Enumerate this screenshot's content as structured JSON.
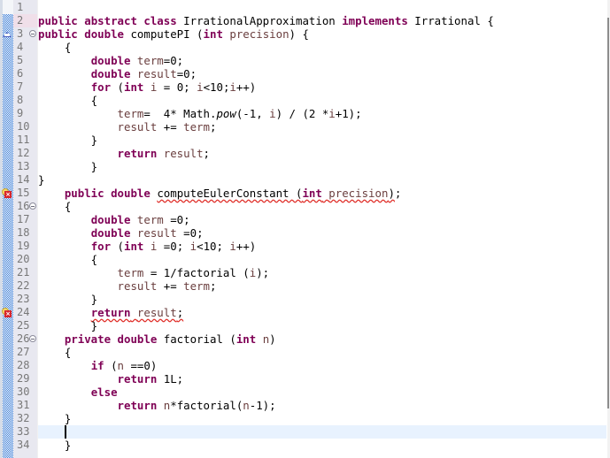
{
  "editor": {
    "language": "java",
    "current_line": 33,
    "colors": {
      "keyword": "#7f0055",
      "local_variable": "#6a3e3e",
      "line_number": "#787878",
      "current_line_bg": "#e8f2fe",
      "error_underline": "#e0302a"
    },
    "lines": [
      {
        "n": "1",
        "tokens": []
      },
      {
        "n": "2",
        "tokens": [
          {
            "t": "public",
            "c": "kw"
          },
          {
            "t": " "
          },
          {
            "t": "abstract",
            "c": "kw"
          },
          {
            "t": " "
          },
          {
            "t": "class",
            "c": "kw"
          },
          {
            "t": " IrrationalApproximation "
          },
          {
            "t": "implements",
            "c": "kw"
          },
          {
            "t": " Irrational {"
          }
        ]
      },
      {
        "n": "3",
        "tokens": [
          {
            "t": "public",
            "c": "kw"
          },
          {
            "t": " "
          },
          {
            "t": "double",
            "c": "kw"
          },
          {
            "t": " computePI ("
          },
          {
            "t": "int",
            "c": "kw"
          },
          {
            "t": " "
          },
          {
            "t": "precision",
            "c": "var"
          },
          {
            "t": ") {"
          }
        ]
      },
      {
        "n": "4",
        "tokens": [
          {
            "t": "    {"
          }
        ]
      },
      {
        "n": "5",
        "tokens": [
          {
            "t": "        "
          },
          {
            "t": "double",
            "c": "kw"
          },
          {
            "t": " "
          },
          {
            "t": "term",
            "c": "var"
          },
          {
            "t": "=0;"
          }
        ]
      },
      {
        "n": "6",
        "tokens": [
          {
            "t": "        "
          },
          {
            "t": "double",
            "c": "kw"
          },
          {
            "t": " "
          },
          {
            "t": "result",
            "c": "var"
          },
          {
            "t": "=0;"
          }
        ]
      },
      {
        "n": "7",
        "tokens": [
          {
            "t": "        "
          },
          {
            "t": "for",
            "c": "kw"
          },
          {
            "t": " ("
          },
          {
            "t": "int",
            "c": "kw"
          },
          {
            "t": " "
          },
          {
            "t": "i",
            "c": "var"
          },
          {
            "t": " = 0; "
          },
          {
            "t": "i",
            "c": "var"
          },
          {
            "t": "<10;"
          },
          {
            "t": "i",
            "c": "var"
          },
          {
            "t": "++)"
          }
        ]
      },
      {
        "n": "8",
        "tokens": [
          {
            "t": "        {"
          }
        ]
      },
      {
        "n": "9",
        "tokens": [
          {
            "t": "            "
          },
          {
            "t": "term",
            "c": "var"
          },
          {
            "t": "=  4* Math."
          },
          {
            "t": "pow",
            "c": "it"
          },
          {
            "t": "(-1, "
          },
          {
            "t": "i",
            "c": "var"
          },
          {
            "t": ") / (2 *"
          },
          {
            "t": "i",
            "c": "var"
          },
          {
            "t": "+1);"
          }
        ]
      },
      {
        "n": "10",
        "tokens": [
          {
            "t": "            "
          },
          {
            "t": "result",
            "c": "var"
          },
          {
            "t": " += "
          },
          {
            "t": "term",
            "c": "var"
          },
          {
            "t": ";"
          }
        ]
      },
      {
        "n": "11",
        "tokens": [
          {
            "t": "        }"
          }
        ]
      },
      {
        "n": "12",
        "tokens": [
          {
            "t": "            "
          },
          {
            "t": "return",
            "c": "kw"
          },
          {
            "t": " "
          },
          {
            "t": "result",
            "c": "var"
          },
          {
            "t": ";"
          }
        ]
      },
      {
        "n": "13",
        "tokens": [
          {
            "t": "        }"
          }
        ]
      },
      {
        "n": "14",
        "tokens": [
          {
            "t": "}"
          }
        ]
      },
      {
        "n": "15",
        "tokens": [
          {
            "t": "    "
          },
          {
            "t": "public",
            "c": "kw"
          },
          {
            "t": " "
          },
          {
            "t": "double",
            "c": "kw"
          },
          {
            "t": " "
          },
          {
            "t": "computeEulerConstant (",
            "c": "err"
          },
          {
            "t": "int",
            "c": "kw err"
          },
          {
            "t": " ",
            "c": "err"
          },
          {
            "t": "precision",
            "c": "var err"
          },
          {
            "t": ")",
            "c": "err"
          },
          {
            "t": ";"
          }
        ]
      },
      {
        "n": "16",
        "tokens": [
          {
            "t": "    {"
          }
        ]
      },
      {
        "n": "17",
        "tokens": [
          {
            "t": "        "
          },
          {
            "t": "double",
            "c": "kw"
          },
          {
            "t": " "
          },
          {
            "t": "term",
            "c": "var"
          },
          {
            "t": " =0;"
          }
        ]
      },
      {
        "n": "18",
        "tokens": [
          {
            "t": "        "
          },
          {
            "t": "double",
            "c": "kw"
          },
          {
            "t": " "
          },
          {
            "t": "result",
            "c": "var"
          },
          {
            "t": " =0;"
          }
        ]
      },
      {
        "n": "19",
        "tokens": [
          {
            "t": "        "
          },
          {
            "t": "for",
            "c": "kw"
          },
          {
            "t": " ("
          },
          {
            "t": "int",
            "c": "kw"
          },
          {
            "t": " "
          },
          {
            "t": "i",
            "c": "var"
          },
          {
            "t": " =0; "
          },
          {
            "t": "i",
            "c": "var"
          },
          {
            "t": "<10; "
          },
          {
            "t": "i",
            "c": "var"
          },
          {
            "t": "++)"
          }
        ]
      },
      {
        "n": "20",
        "tokens": [
          {
            "t": "        {"
          }
        ]
      },
      {
        "n": "21",
        "tokens": [
          {
            "t": "            "
          },
          {
            "t": "term",
            "c": "var"
          },
          {
            "t": " = 1/factorial ("
          },
          {
            "t": "i",
            "c": "var"
          },
          {
            "t": ");"
          }
        ]
      },
      {
        "n": "22",
        "tokens": [
          {
            "t": "            "
          },
          {
            "t": "result",
            "c": "var"
          },
          {
            "t": " += "
          },
          {
            "t": "term",
            "c": "var"
          },
          {
            "t": ";"
          }
        ]
      },
      {
        "n": "23",
        "tokens": [
          {
            "t": "        }"
          }
        ]
      },
      {
        "n": "24",
        "tokens": [
          {
            "t": "        "
          },
          {
            "t": "return",
            "c": "kw err"
          },
          {
            "t": " ",
            "c": "err"
          },
          {
            "t": "result",
            "c": "var err"
          },
          {
            "t": ";",
            "c": "err"
          }
        ]
      },
      {
        "n": "25",
        "tokens": [
          {
            "t": "        }"
          }
        ]
      },
      {
        "n": "26",
        "tokens": [
          {
            "t": "    "
          },
          {
            "t": "private",
            "c": "kw"
          },
          {
            "t": " "
          },
          {
            "t": "double",
            "c": "kw"
          },
          {
            "t": " factorial ("
          },
          {
            "t": "int",
            "c": "kw"
          },
          {
            "t": " "
          },
          {
            "t": "n",
            "c": "var"
          },
          {
            "t": ")"
          }
        ]
      },
      {
        "n": "27",
        "tokens": [
          {
            "t": "    {"
          }
        ]
      },
      {
        "n": "28",
        "tokens": [
          {
            "t": "        "
          },
          {
            "t": "if",
            "c": "kw"
          },
          {
            "t": " ("
          },
          {
            "t": "n",
            "c": "var"
          },
          {
            "t": " ==0)"
          }
        ]
      },
      {
        "n": "29",
        "tokens": [
          {
            "t": "            "
          },
          {
            "t": "return",
            "c": "kw"
          },
          {
            "t": " 1L;"
          }
        ]
      },
      {
        "n": "30",
        "tokens": [
          {
            "t": "        "
          },
          {
            "t": "else",
            "c": "kw"
          }
        ]
      },
      {
        "n": "31",
        "tokens": [
          {
            "t": "            "
          },
          {
            "t": "return",
            "c": "kw"
          },
          {
            "t": " "
          },
          {
            "t": "n",
            "c": "var"
          },
          {
            "t": "*factorial("
          },
          {
            "t": "n",
            "c": "var"
          },
          {
            "t": "-1);"
          }
        ]
      },
      {
        "n": "32",
        "tokens": [
          {
            "t": "    }"
          }
        ]
      },
      {
        "n": "33",
        "tokens": []
      },
      {
        "n": "34",
        "tokens": [
          {
            "t": "    }"
          }
        ]
      }
    ],
    "annotations": {
      "3": "override-icon",
      "15": "error-icon",
      "24": "error-icon"
    },
    "folds": [
      "3",
      "16",
      "26"
    ],
    "highlighted_line_numbers": [
      "2"
    ],
    "caret": {
      "line": "33",
      "column": 4
    }
  }
}
